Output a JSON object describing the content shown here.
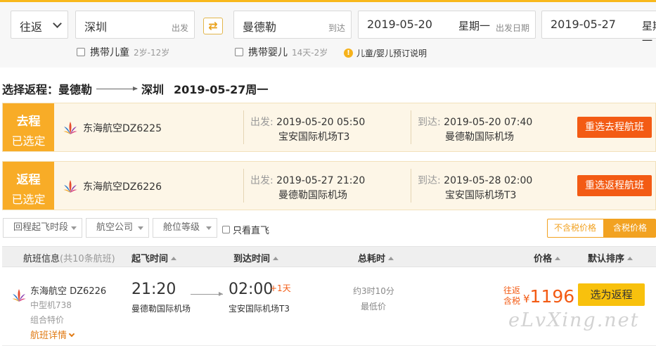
{
  "search": {
    "trip_type": "往返",
    "from_city": "深圳",
    "from_hint": "出发",
    "to_city": "曼德勒",
    "to_hint": "到达",
    "depart_date": "2019-05-20",
    "depart_week": "星期一",
    "depart_hint": "出发日期",
    "return_date": "2019-05-27",
    "return_week": "星期一",
    "child_label": "携带儿童",
    "child_age": "2岁-12岁",
    "infant_label": "携带婴儿",
    "infant_age": "14天-2岁",
    "note": "儿童/婴儿预订说明"
  },
  "title": {
    "prefix": "选择返程：曼德勒",
    "city": "深圳",
    "date": "2019-05-27周一"
  },
  "legs": [
    {
      "tag_top": "去程",
      "tag_bottom": "已选定",
      "airline": "东海航空DZ6225",
      "dep_label": "出发:",
      "dep_time": "2019-05-20 05:50",
      "dep_airport": "宝安国际机场T3",
      "arr_label": "到达:",
      "arr_time": "2019-05-20 07:40",
      "arr_airport": "曼德勒国际机场",
      "button": "重选去程航班"
    },
    {
      "tag_top": "返程",
      "tag_bottom": "已选定",
      "airline": "东海航空DZ6226",
      "dep_label": "出发:",
      "dep_time": "2019-05-27 21:20",
      "dep_airport": "曼德勒国际机场",
      "arr_label": "到达:",
      "arr_time": "2019-05-28 02:00",
      "arr_airport": "宝安国际机场T3",
      "button": "重选返程航班"
    }
  ],
  "filters": {
    "dep_time": "回程起飞时段",
    "airline": "航空公司",
    "cabin": "舱位等级",
    "direct": "只看直飞",
    "price_excl_tax": "不含税价格",
    "price_incl_tax": "含税价格"
  },
  "list_header": {
    "info": "航班信息",
    "count": "(共10条航班)",
    "dep": "起飞时间",
    "arr": "到达时间",
    "duration": "总耗时",
    "price": "价格",
    "sort": "默认排序"
  },
  "flights": [
    {
      "airline": "东海航空 DZ6226",
      "plane": "中型机738",
      "tag": "组合特价",
      "detail": "航班详情",
      "dep_time": "21:20",
      "dep_airport": "曼德勒国际机场",
      "arr_time": "02:00",
      "plus_day": "+1天",
      "arr_airport": "宝安国际机场T3",
      "duration": "约3时10分",
      "price_note": "最低价",
      "price_tag1": "往返",
      "price_tag2": "含税",
      "currency": "¥",
      "price": "1196",
      "button": "选为返程"
    }
  ],
  "watermark": "eLvXing.net",
  "colors": {
    "accent": "#f8ac27",
    "button_red": "#f35b14",
    "choose_yellow": "#f8c10d"
  }
}
